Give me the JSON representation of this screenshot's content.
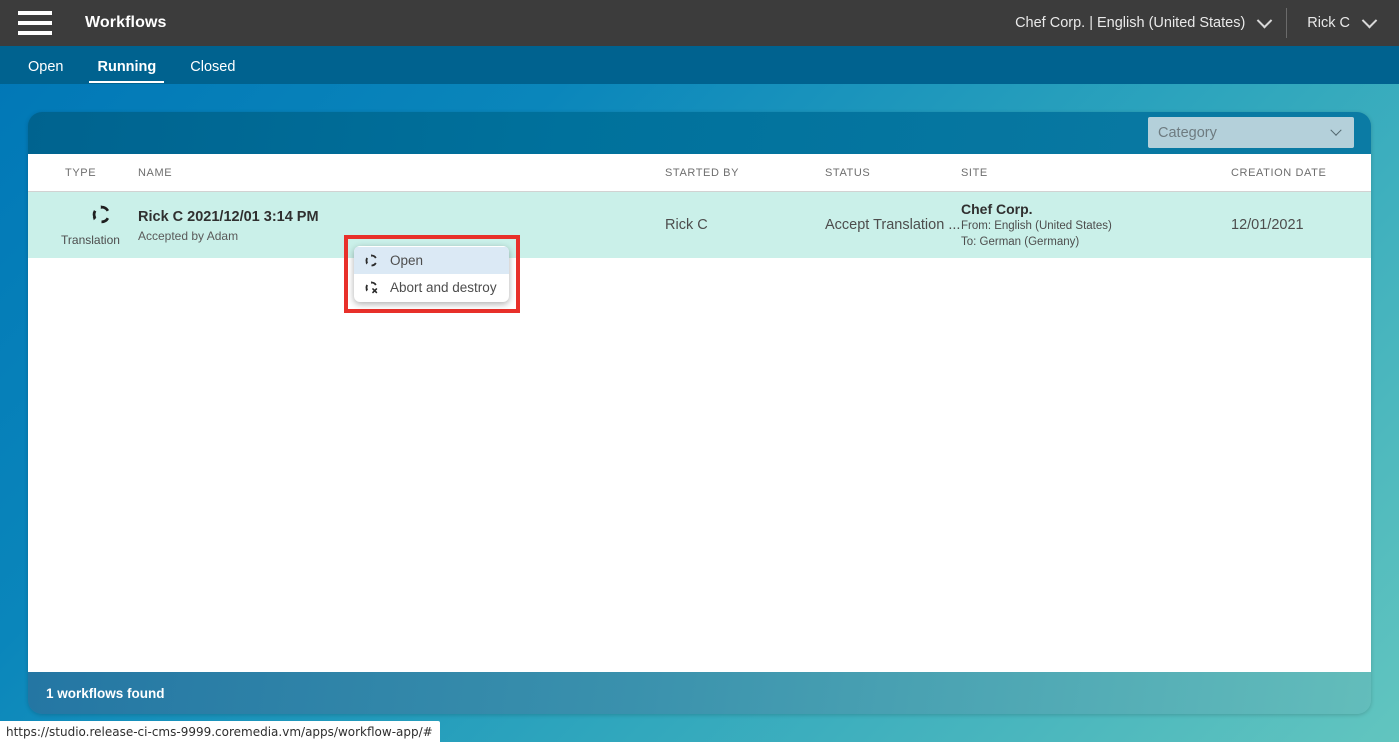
{
  "header": {
    "menu_icon": "hamburger-icon",
    "title": "Workflows",
    "site_label": "Chef Corp. | English (United States)",
    "user_label": "Rick C"
  },
  "tabs": [
    {
      "label": "Open",
      "active": false
    },
    {
      "label": "Running",
      "active": true
    },
    {
      "label": "Closed",
      "active": false
    }
  ],
  "toolbar": {
    "category_placeholder": "Category"
  },
  "table": {
    "columns": [
      "TYPE",
      "NAME",
      "STARTED BY",
      "STATUS",
      "SITE",
      "CREATION DATE"
    ],
    "rows": [
      {
        "type_icon": "translation-icon",
        "type_label": "Translation",
        "name_main": "Rick C 2021/12/01 3:14 PM",
        "name_sub": "Accepted by Adam",
        "started_by": "Rick C",
        "status": "Accept Translation ...",
        "site_main": "Chef Corp.",
        "site_from": "From: English (United States)",
        "site_to": "To: German (Germany)",
        "creation_date": "12/01/2021"
      }
    ]
  },
  "context_menu": {
    "items": [
      {
        "icon": "open-workflow-icon",
        "label": "Open",
        "hovered": true
      },
      {
        "icon": "abort-destroy-icon",
        "label": "Abort and destroy",
        "hovered": false
      }
    ]
  },
  "footer": {
    "result_count_text": "1 workflows found"
  },
  "statusbar": {
    "url": "https://studio.release-ci-cms-9999.coremedia.vm/apps/workflow-app/#"
  },
  "colors": {
    "topbar": "#3c3c3c",
    "tabbar": "#00628f",
    "accent_blue": "#00719c",
    "selected_row": "#caf0e9",
    "highlight_red": "#e8302a",
    "menu_hover": "#dbe9f5"
  }
}
